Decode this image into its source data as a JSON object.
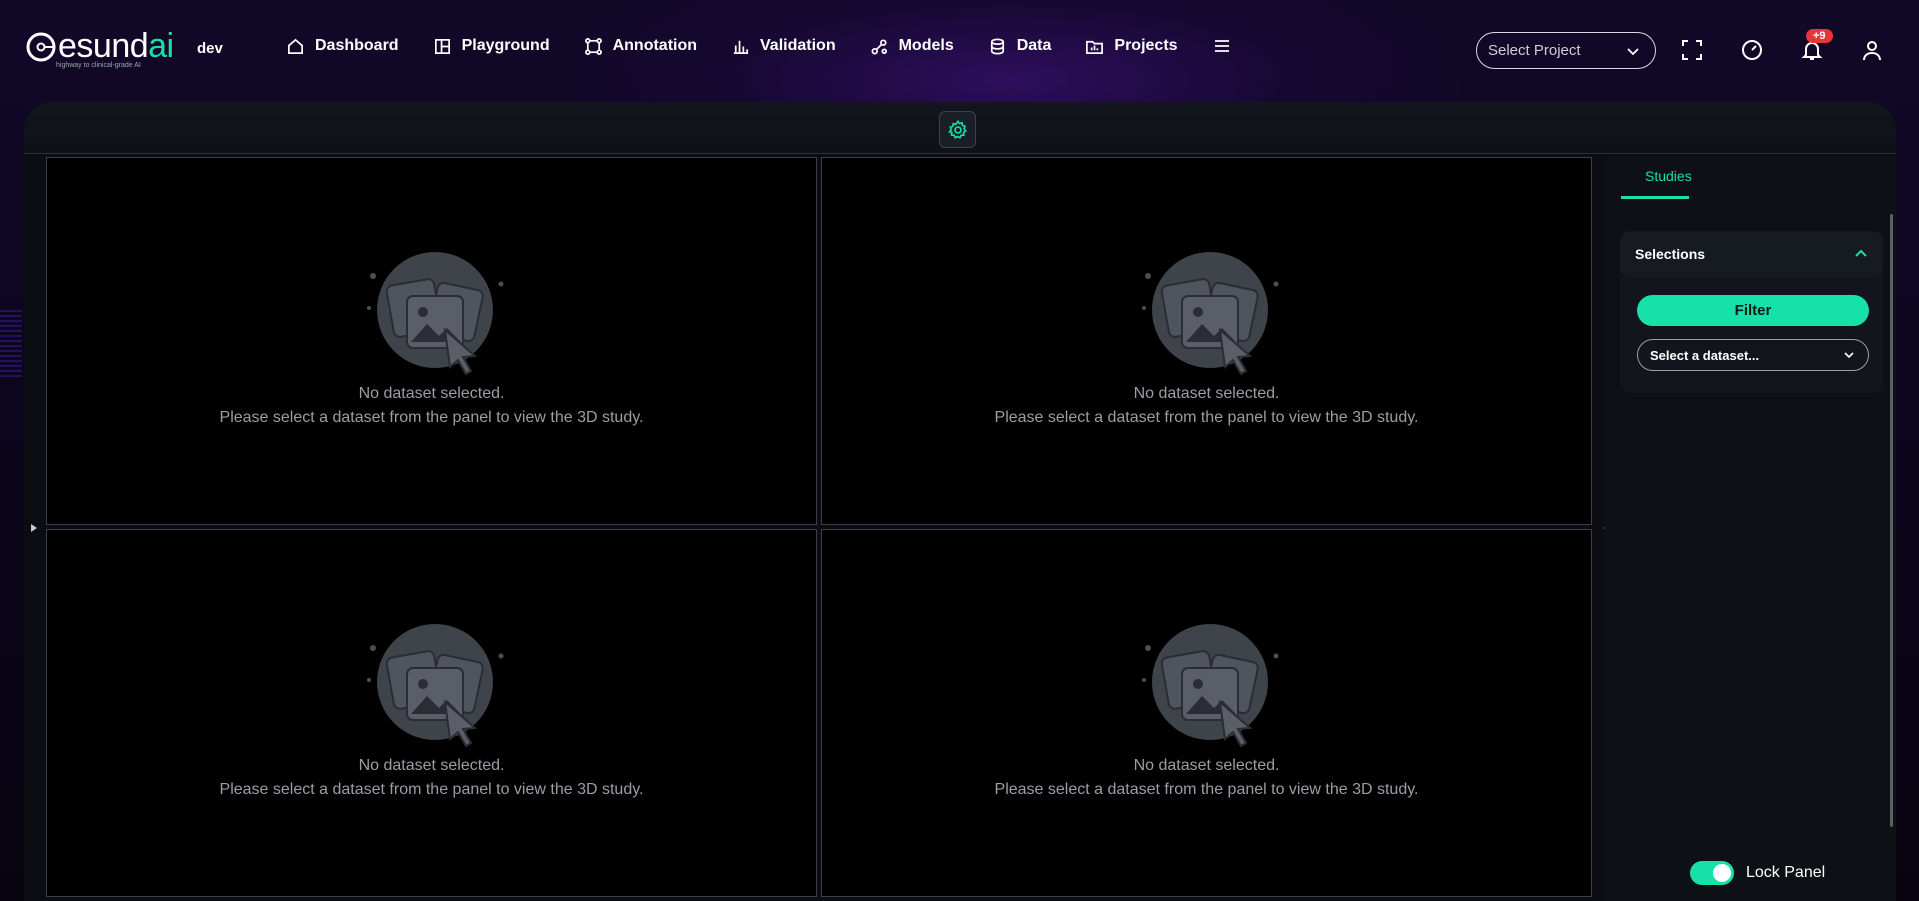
{
  "brand": {
    "name_main": "esund",
    "name_accent": "ai",
    "tagline": "highway to clinical-grade AI",
    "env": "dev"
  },
  "nav": [
    {
      "label": "Dashboard",
      "icon": "home-icon"
    },
    {
      "label": "Playground",
      "icon": "playground-icon"
    },
    {
      "label": "Annotation",
      "icon": "annotation-icon"
    },
    {
      "label": "Validation",
      "icon": "bar-chart-icon"
    },
    {
      "label": "Models",
      "icon": "models-icon"
    },
    {
      "label": "Data",
      "icon": "database-icon"
    },
    {
      "label": "Projects",
      "icon": "projects-icon"
    }
  ],
  "topbar": {
    "project_placeholder": "Select Project",
    "notification_count": "+9"
  },
  "viewports": [
    {
      "line1": "No dataset selected.",
      "line2": "Please select a dataset from the panel to view the 3D study."
    },
    {
      "line1": "No dataset selected.",
      "line2": "Please select a dataset from the panel to view the 3D study."
    },
    {
      "line1": "No dataset selected.",
      "line2": "Please select a dataset from the panel to view the 3D study."
    },
    {
      "line1": "No dataset selected.",
      "line2": "Please select a dataset from the panel to view the 3D study."
    }
  ],
  "panel": {
    "tab": "Studies",
    "selections_title": "Selections",
    "filter_label": "Filter",
    "dataset_placeholder": "Select a dataset...",
    "lock_label": "Lock Panel",
    "lock_enabled": true
  },
  "colors": {
    "accent": "#17e0a8",
    "badge": "#e5373a",
    "background": "#0b0d12"
  }
}
